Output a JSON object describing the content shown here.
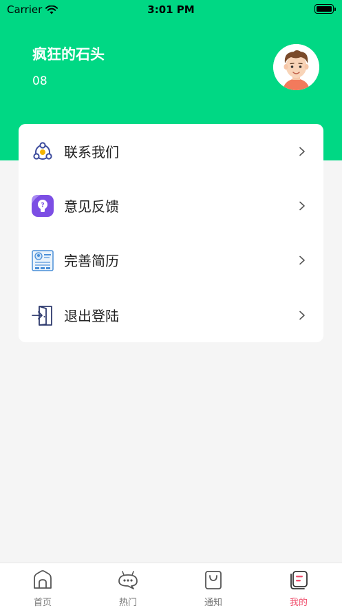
{
  "status_bar": {
    "carrier": "Carrier",
    "time": "3:01 PM"
  },
  "profile": {
    "name": "疯狂的石头",
    "id": "08"
  },
  "menu": [
    {
      "label": "联系我们",
      "icon": "contact-network-icon"
    },
    {
      "label": "意见反馈",
      "icon": "feedback-lightbulb-icon"
    },
    {
      "label": "完善简历",
      "icon": "resume-icon"
    },
    {
      "label": "退出登陆",
      "icon": "logout-door-icon"
    }
  ],
  "tabs": [
    {
      "label": "首页",
      "icon": "home-icon"
    },
    {
      "label": "热门",
      "icon": "hot-chat-icon"
    },
    {
      "label": "通知",
      "icon": "notification-bag-icon"
    },
    {
      "label": "我的",
      "icon": "profile-card-icon",
      "active": true
    }
  ],
  "colors": {
    "header": "#00d884",
    "active_tab": "#f0506e",
    "background": "#f5f5f5"
  }
}
